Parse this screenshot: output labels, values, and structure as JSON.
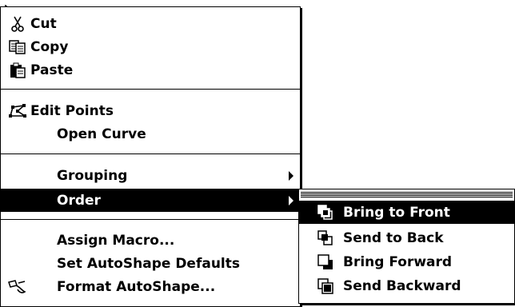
{
  "context_menu": {
    "items": [
      {
        "label": "Cut",
        "icon": "scissors-icon"
      },
      {
        "label": "Copy",
        "icon": "copy-icon"
      },
      {
        "label": "Paste",
        "icon": "clipboard-icon"
      },
      {
        "label": "Edit Points",
        "icon": "edit-points-icon"
      },
      {
        "label": "Open Curve"
      },
      {
        "label": "Grouping",
        "has_submenu": true
      },
      {
        "label": "Order",
        "has_submenu": true,
        "highlighted": true
      },
      {
        "label": "Assign Macro..."
      },
      {
        "label": "Set AutoShape Defaults"
      },
      {
        "label": "Format AutoShape...",
        "icon": "format-brush-icon"
      }
    ]
  },
  "order_submenu": {
    "items": [
      {
        "label": "Bring to Front",
        "icon": "bring-to-front-icon",
        "highlighted": true
      },
      {
        "label": "Send to Back",
        "icon": "send-to-back-icon"
      },
      {
        "label": "Bring Forward",
        "icon": "bring-forward-icon"
      },
      {
        "label": "Send Backward",
        "icon": "send-backward-icon"
      }
    ]
  },
  "colors": {
    "menu_bg": "#ffffff",
    "highlight_bg": "#000000",
    "text": "#000000",
    "highlight_text": "#ffffff"
  }
}
